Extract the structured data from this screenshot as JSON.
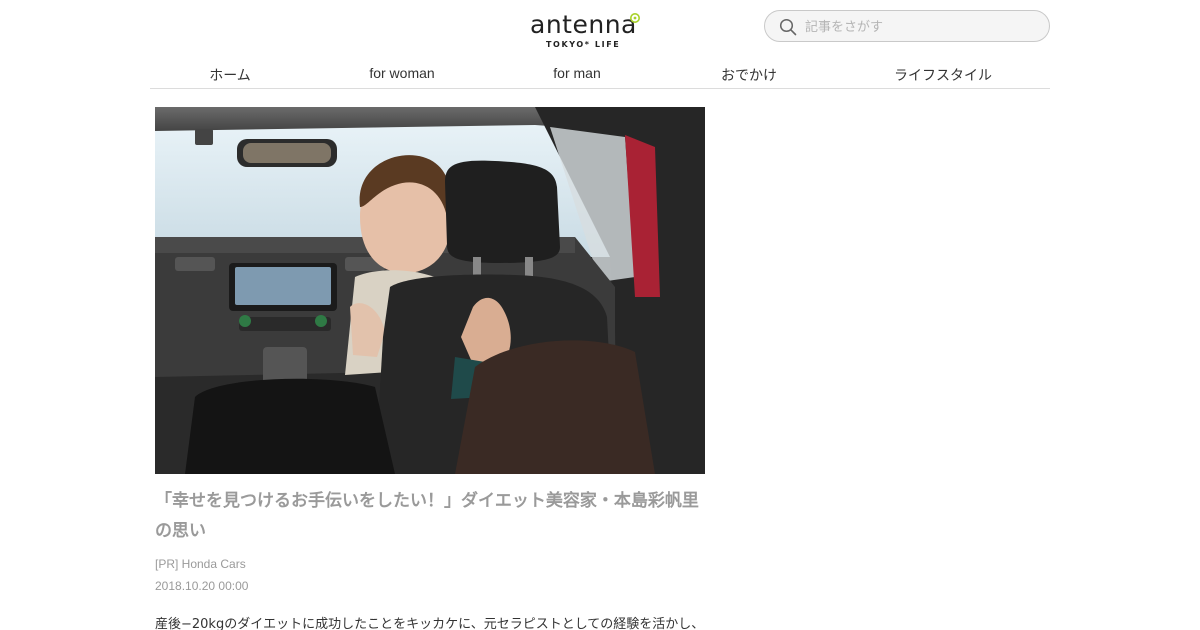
{
  "header": {
    "logo_text": "antenna",
    "logo_tagline": "TOKYO* LIFE",
    "search_placeholder": "記事をさがす"
  },
  "nav": {
    "items": [
      "ホーム",
      "for woman",
      "for man",
      "おでかけ",
      "ライフスタイル"
    ]
  },
  "article": {
    "title": "「幸せを見つけるお手伝いをしたい！」ダイエット美容家・本島彩帆里の思い",
    "sponsor": "[PR] Honda Cars",
    "date": "2018.10.20 00:00",
    "excerpt": "産後−20kgのダイエットに成功したことをキッカケに、元セラピストとしての経験を活かし、"
  },
  "colors": {
    "accent_logo": "#a8d22a",
    "muted_text": "#9a9a9a"
  }
}
